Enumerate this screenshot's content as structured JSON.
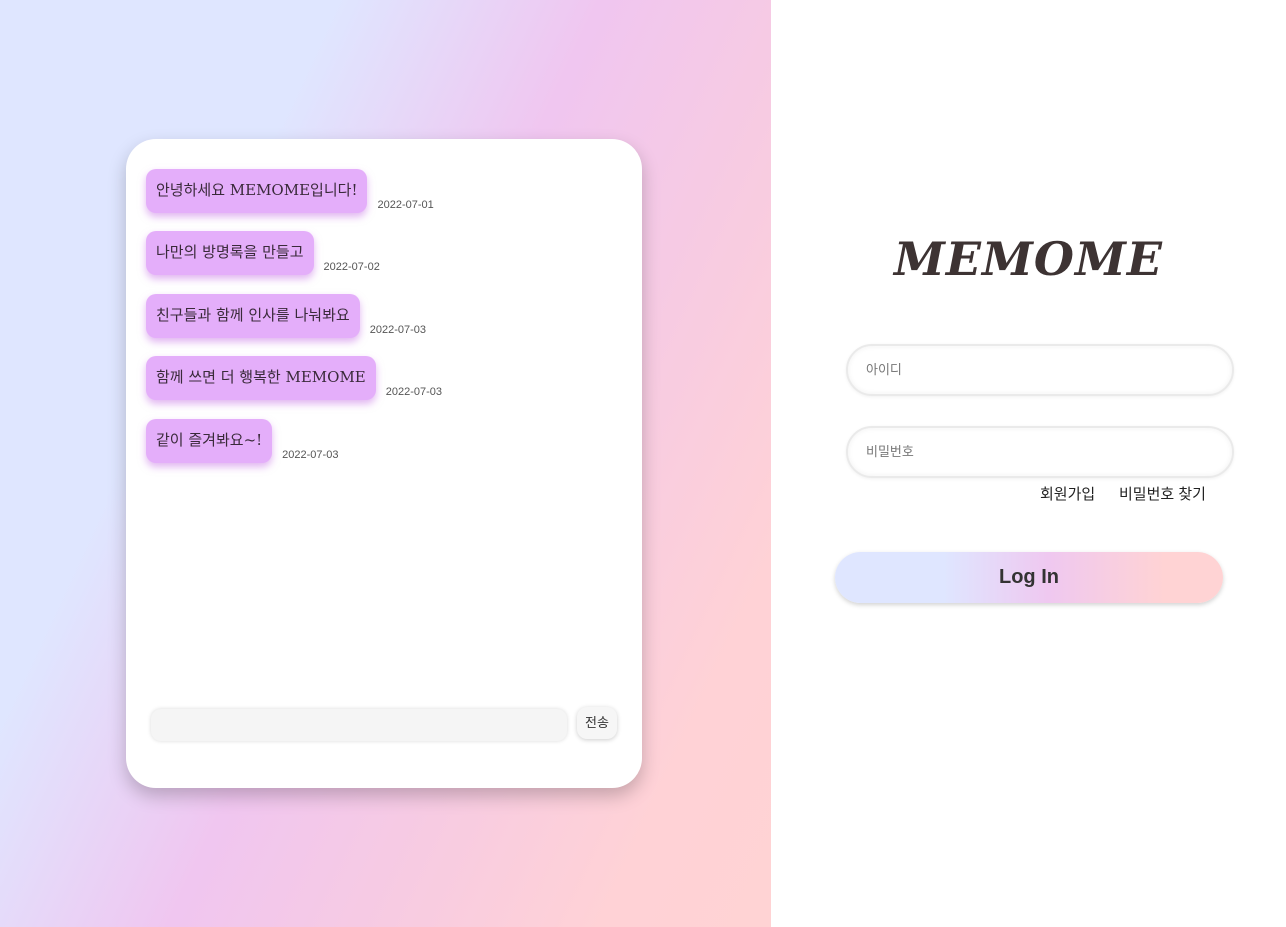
{
  "chat": {
    "messages": [
      {
        "text": "안녕하세요 MEMOME입니다!",
        "date": "2022-07-01"
      },
      {
        "text": "나만의 방명록을 만들고",
        "date": "2022-07-02"
      },
      {
        "text": "친구들과 함께 인사를 나눠봐요",
        "date": "2022-07-03"
      },
      {
        "text": "함께 쓰면 더 행복한 MEMOME",
        "date": "2022-07-03"
      },
      {
        "text": "같이 즐겨봐요~!",
        "date": "2022-07-03"
      }
    ],
    "input_value": "",
    "send_label": "전송",
    "bubble_color": "#e4aefa"
  },
  "login": {
    "logo": "MEMOME",
    "id_placeholder": "아이디",
    "password_placeholder": "비밀번호",
    "signup_link": "회원가입",
    "find_password_link": "비밀번호 찾기",
    "login_button": "Log In"
  }
}
